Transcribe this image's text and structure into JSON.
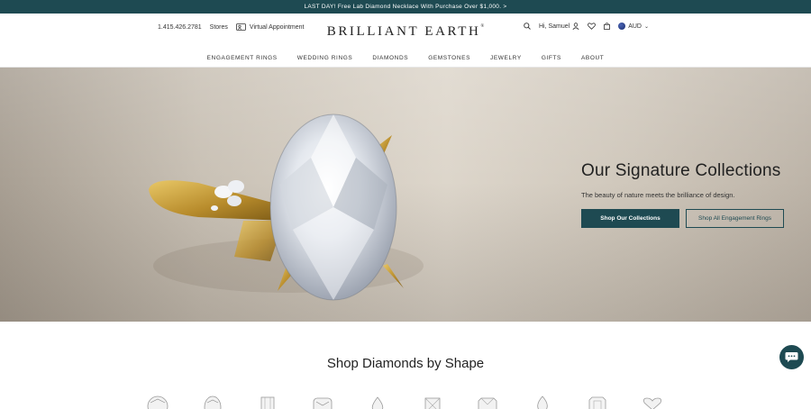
{
  "promo": {
    "text": "LAST DAY! Free Lab Diamond Necklace With Purchase Over $1,000. >"
  },
  "header": {
    "phone": "1.415.426.2781",
    "stores": "Stores",
    "virtual_appointment": "Virtual Appointment",
    "logo": "BRILLIANT EARTH",
    "logo_mark": "®",
    "greeting": "Hi, Samuel",
    "currency": "AUD"
  },
  "nav": [
    "ENGAGEMENT RINGS",
    "WEDDING RINGS",
    "DIAMONDS",
    "GEMSTONES",
    "JEWELRY",
    "GIFTS",
    "ABOUT"
  ],
  "hero": {
    "title": "Our Signature Collections",
    "subtitle": "The beauty of nature meets the brilliance of design.",
    "primary_button": "Shop Our Collections",
    "secondary_button": "Shop All Engagement Rings"
  },
  "shape_section": {
    "title": "Shop Diamonds by Shape",
    "shapes": [
      "round-icon",
      "oval-icon",
      "emerald-icon",
      "cushion-icon",
      "pear-icon",
      "princess-icon",
      "radiant-icon",
      "marquise-icon",
      "asscher-icon",
      "heart-icon"
    ]
  },
  "colors": {
    "brand": "#1e4a52",
    "gold": "#c9a341"
  }
}
